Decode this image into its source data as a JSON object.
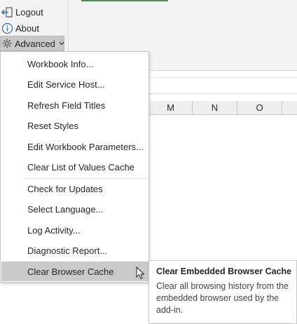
{
  "ribbon": {
    "logout_label": "Logout",
    "about_label": "About",
    "advanced_label": "Advanced"
  },
  "sheet": {
    "columns": [
      "M",
      "N",
      "O"
    ]
  },
  "menu": {
    "items": [
      {
        "label": "Workbook Info..."
      },
      {
        "label": "Edit Service Host..."
      },
      {
        "label": "Refresh Field Titles"
      },
      {
        "label": "Reset Styles"
      },
      {
        "label": "Edit Workbook Parameters..."
      },
      {
        "label": "Clear List of Values Cache"
      },
      {
        "label": "Check for Updates"
      },
      {
        "label": "Select Language..."
      },
      {
        "label": "Log Activity..."
      },
      {
        "label": "Diagnostic Report..."
      },
      {
        "label": "Clear Browser Cache",
        "selected": true
      }
    ]
  },
  "tooltip": {
    "title": "Clear Embedded Browser Cache",
    "body": "Clear all browsing history from the embedded browser used by the add-in."
  },
  "colors": {
    "selected_bg": "#c9c9c9",
    "ribbon_bg": "#f3f3f3",
    "icon_blue": "#3a6fa8"
  },
  "icons": {
    "logout": "logout-icon",
    "about": "info-icon",
    "advanced": "gear-icon",
    "chevron": "chevron-down-icon",
    "cursor": "mouse-pointer-icon"
  }
}
